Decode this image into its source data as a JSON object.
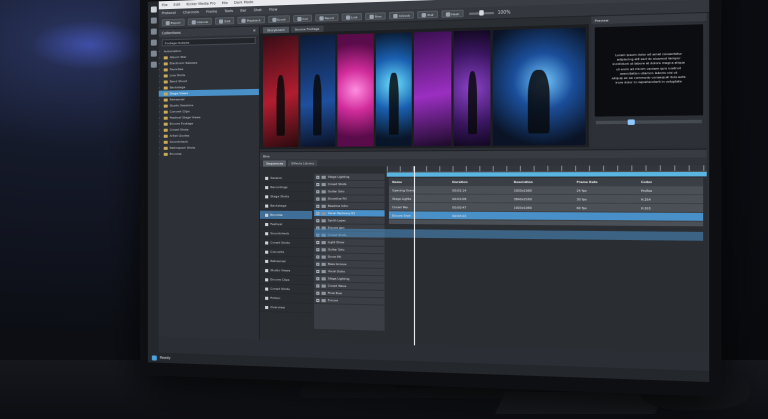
{
  "window": {
    "title_parts": [
      "File",
      "Edit",
      "Kicker Media Pro",
      "Mix",
      "Dark Mode"
    ]
  },
  "menu": [
    "Protocol",
    "Channels",
    "Frame",
    "Tools",
    "Bar",
    "Shot",
    "Flow"
  ],
  "toolbar": {
    "buttons": [
      "Export",
      "Interval",
      "Edit",
      "Playback",
      "Scroll",
      "Cut",
      "Pencil",
      "Link",
      "Trim",
      "Unlock",
      "Pull",
      "Hash"
    ],
    "zoom_label": "100%"
  },
  "left_panel": {
    "title": "Collections",
    "search_placeholder": "Footage Outside",
    "items": [
      {
        "label": "Automation",
        "folder": false
      },
      {
        "label": "Album Star",
        "folder": true
      },
      {
        "label": "Electronic Release",
        "folder": true
      },
      {
        "label": "Favorites",
        "folder": true
      },
      {
        "label": "Live Shots",
        "folder": true
      },
      {
        "label": "Band Shoot",
        "folder": true
      },
      {
        "label": "Backstage",
        "folder": true
      },
      {
        "label": "Stage Views",
        "folder": true,
        "selected": true
      },
      {
        "label": "Rehearsal",
        "folder": true
      },
      {
        "label": "Studio Sessions",
        "folder": true
      },
      {
        "label": "Concert Clips",
        "folder": true
      },
      {
        "label": "Festival Stage Views",
        "folder": true
      },
      {
        "label": "Encore Footage",
        "folder": true
      },
      {
        "label": "Crowd Shots",
        "folder": true
      },
      {
        "label": "Artist Quotes",
        "folder": true
      },
      {
        "label": "Soundcheck",
        "folder": true
      },
      {
        "label": "Retrospect Shots",
        "folder": true
      },
      {
        "label": "Encores",
        "folder": true
      }
    ]
  },
  "viewer": {
    "tabs": [
      "Storyboard",
      "Source Footage"
    ]
  },
  "preview": {
    "title": "Preview",
    "lines": [
      "Lorem ipsum dolor sit amet consectetur",
      "adipiscing elit sed do eiusmod tempor",
      "incididunt ut labore et dolore magna aliqua",
      "ut enim ad minim veniam quis nostrud",
      "exercitation ullamco laboris nisi ut",
      "aliquip ex ea commodo consequat duis aute",
      "irure dolor in reprehenderit in voluptate"
    ]
  },
  "timeline": {
    "title": "Bins",
    "tabs": [
      "Sequences",
      "Effects Library"
    ],
    "track_labels": [
      "Session",
      "Recordings",
      "Stage Shots",
      "Backstage",
      "Encores",
      "Festival",
      "Soundcheck",
      "Crowd Shots",
      "Concerts",
      "Rehearsal",
      "Studio Views",
      "Encore Clips",
      "Crowd Shots",
      "Fiction",
      "Overview"
    ],
    "clips": [
      "Stage Lighting",
      "Crowd Shots",
      "Guitar Solo",
      "Drumline Fill",
      "Bassline Intro",
      "Vocal Harmony 01",
      "Synth Layer",
      "Encore Jam",
      "Crowd Shots",
      "Light Show",
      "Guitar Solo",
      "Drum Fill",
      "Bass Groove",
      "Vocal Outro",
      "Stage Lighting",
      "Crowd Wave",
      "Final Bow",
      "Encore"
    ],
    "grid_header": [
      "Name",
      "Duration",
      "Resolution",
      "Frame Rate",
      "Codec"
    ],
    "grid_rows": [
      [
        "Opening Scene",
        "00:02:14",
        "1920x1080",
        "24 fps",
        "ProRes"
      ],
      [
        "Stage Lights",
        "00:01:08",
        "3840x2160",
        "30 fps",
        "H.264"
      ],
      [
        "Crowd Pan",
        "00:00:47",
        "1920x1080",
        "60 fps",
        "H.265"
      ],
      [
        "Encore Shot",
        "00:03:22",
        "",
        "",
        ""
      ]
    ]
  },
  "status": {
    "text": "Ready"
  }
}
